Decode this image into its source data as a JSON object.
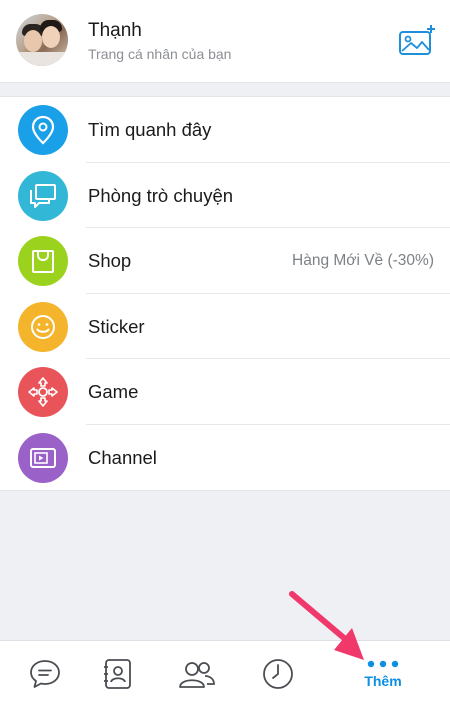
{
  "profile": {
    "name": "Thạnh",
    "subtitle": "Trang cá nhân của bạn"
  },
  "menu": {
    "items": [
      {
        "label": "Tìm quanh đây",
        "icon": "location-pin-icon",
        "color": "#1aa0e8",
        "right_text": ""
      },
      {
        "label": "Phòng trò chuyện",
        "icon": "chat-rooms-icon",
        "color": "#33b7d6",
        "right_text": ""
      },
      {
        "label": "Shop",
        "icon": "shopping-bag-icon",
        "color": "#9bd21e",
        "right_text": "Hàng Mới Về (-30%)"
      },
      {
        "label": "Sticker",
        "icon": "smiley-icon",
        "color": "#f4b52d",
        "right_text": ""
      },
      {
        "label": "Game",
        "icon": "gamepad-arrows-icon",
        "color": "#e9545a",
        "right_text": ""
      },
      {
        "label": "Channel",
        "icon": "video-channel-icon",
        "color": "#9a62c9",
        "right_text": ""
      }
    ]
  },
  "bottom_nav": {
    "items": [
      {
        "name": "messages",
        "icon": "chat-bubble-icon",
        "label": ""
      },
      {
        "name": "contacts",
        "icon": "contact-card-icon",
        "label": ""
      },
      {
        "name": "groups",
        "icon": "people-icon",
        "label": ""
      },
      {
        "name": "timeline",
        "icon": "clock-icon",
        "label": ""
      },
      {
        "name": "more",
        "icon": "more-dots-icon",
        "label": "Thêm",
        "active": true
      }
    ]
  },
  "colors": {
    "accent": "#0a8fe3",
    "annotation_arrow": "#f0386b",
    "background": "#eef0f3"
  }
}
